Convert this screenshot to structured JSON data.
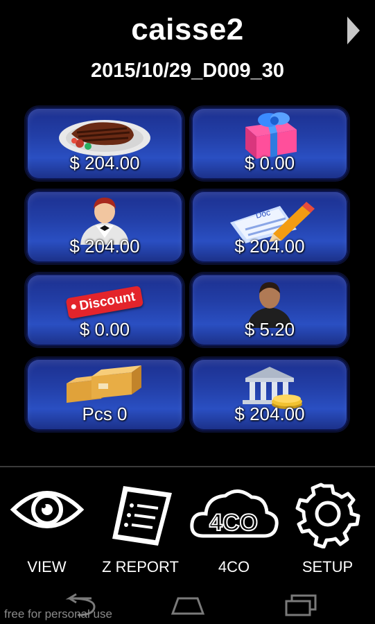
{
  "header": {
    "title": "caisse2",
    "subtitle": "2015/10/29_D009_30",
    "next_icon": "triangle-right-icon"
  },
  "tiles": [
    {
      "name": "sales",
      "icon": "steak-plate-icon",
      "label": "$ 204.00"
    },
    {
      "name": "gifts",
      "icon": "gift-box-icon",
      "label": "$ 0.00"
    },
    {
      "name": "waiter",
      "icon": "waiter-icon",
      "label": "$ 204.00"
    },
    {
      "name": "documents",
      "icon": "document-pencil-icon",
      "label": "$ 204.00"
    },
    {
      "name": "discount",
      "icon": "discount-tag-icon",
      "tag_text": "Discount",
      "label": "$ 0.00"
    },
    {
      "name": "customer",
      "icon": "customer-icon",
      "label": "$ 5.20"
    },
    {
      "name": "pieces",
      "icon": "boxes-icon",
      "label": "Pcs 0"
    },
    {
      "name": "bank",
      "icon": "bank-coins-icon",
      "label": "$ 204.00"
    }
  ],
  "bottom_nav": [
    {
      "name": "view",
      "icon": "eye-icon",
      "label": "VIEW"
    },
    {
      "name": "z-report",
      "icon": "receipt-icon",
      "label": "Z REPORT"
    },
    {
      "name": "4co",
      "icon": "cloud-4co-icon",
      "label": "4CO",
      "icon_text": "4CO"
    },
    {
      "name": "setup",
      "icon": "gear-icon",
      "label": "SETUP"
    }
  ],
  "system_bar": {
    "back_icon": "back-arrow-icon",
    "home_icon": "home-icon",
    "recents_icon": "recent-apps-icon"
  },
  "watermark": "free for personal use",
  "colors": {
    "tile_blue": "#223ea6",
    "background": "#000000"
  }
}
